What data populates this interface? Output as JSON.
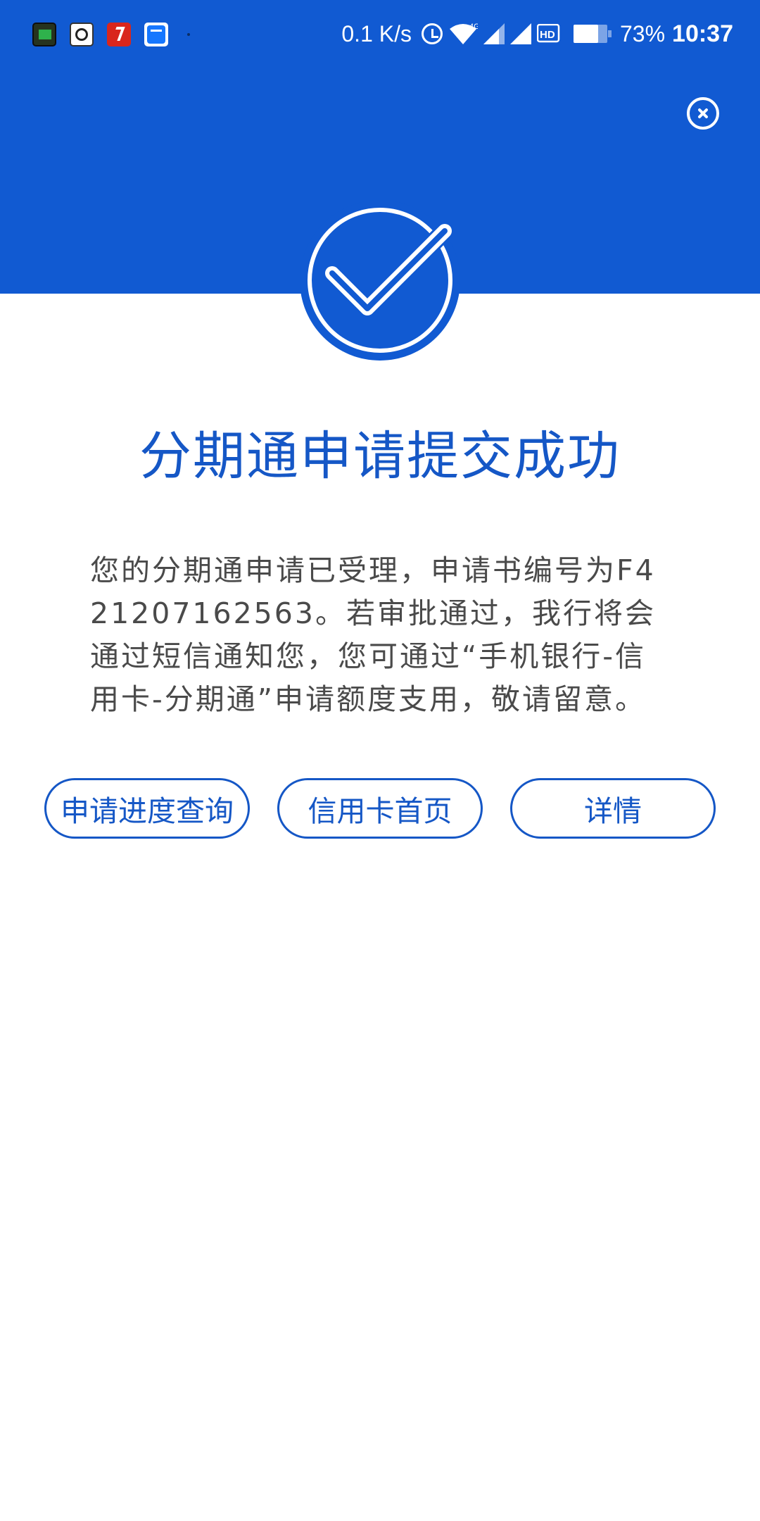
{
  "status_bar": {
    "net_speed": "0.1 K/s",
    "network_type": "4G",
    "hd_label": "HD",
    "battery_percent": "73%",
    "battery_level": 0.73,
    "time": "10:37"
  },
  "header": {
    "title": "分期通申请提交成功"
  },
  "main": {
    "message": "您的分期通申请已受理，申请书编号为F421207162563。若审批通过，我行将会通过短信通知您，您可通过“手机银行-信用卡-分期通”申请额度支用，敬请留意。"
  },
  "buttons": {
    "progress": "申请进度查询",
    "credit_home": "信用卡首页",
    "details": "详情"
  },
  "colors": {
    "primary": "#115ad2",
    "text_blue": "#1557c6",
    "body_text": "#4a4a4a"
  }
}
